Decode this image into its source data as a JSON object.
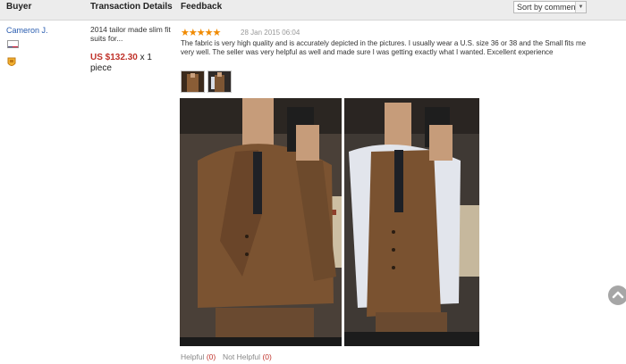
{
  "header": {
    "buyer": "Buyer",
    "transaction": "Transaction Details",
    "feedback": "Feedback",
    "sort_label": "Sort by comment"
  },
  "review": {
    "buyer_name": "Cameron J.",
    "country_flag_icon": "us-flag-icon",
    "product_title": "2014 tailor made slim fit suits for...",
    "price": "US $132.30",
    "quantity": "x 1 piece",
    "rating": 5,
    "stars": "★★★★★",
    "date": "28 Jan 2015 06:04",
    "feedback_text": "The fabric is very high quality and is accurately depicted in the pictures. I usually wear a U.S. size 36 or 38 and the Small fits me very well. The seller was very helpful as well and made sure I was getting exactly what I wanted. Excellent experience",
    "helpful_label": "Helpful",
    "helpful_count": "(0)",
    "not_helpful_label": "Not Helpful",
    "not_helpful_count": "(0)"
  },
  "colors": {
    "link": "#2a5db0",
    "price": "#c0332b",
    "stars": "#f08a00",
    "header_bg": "#ececec"
  }
}
